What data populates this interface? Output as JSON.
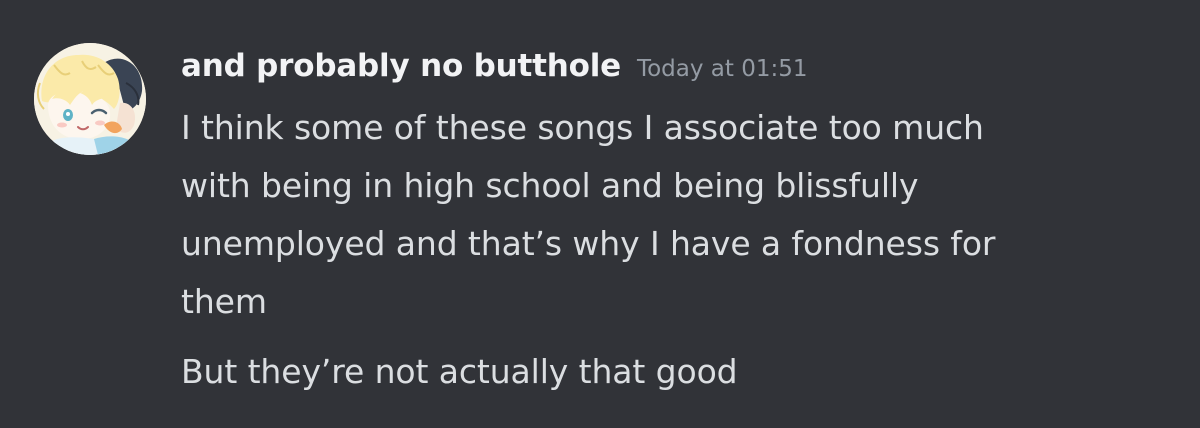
{
  "message": {
    "username": "and probably no butthole",
    "timestamp": "Today at 01:51",
    "avatar_icon": "user-avatar-icon",
    "lines": [
      "I think some of these songs I associate too much",
      "with being in high school and being blissfully",
      "unemployed and that’s why I have a fondness for",
      "them"
    ],
    "followup": "But they’re not actually that good"
  },
  "colors": {
    "background": "#313338",
    "username": "#f2f3f5",
    "timestamp": "#949ba4",
    "text": "#dbdee1"
  }
}
